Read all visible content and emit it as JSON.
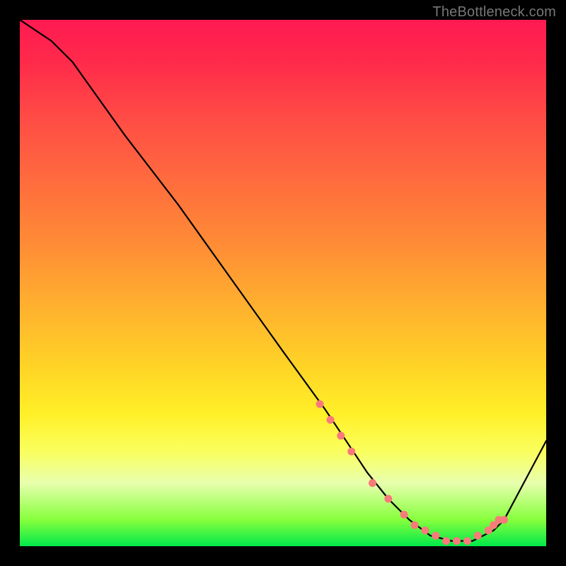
{
  "watermark": "TheBottleneck.com",
  "chart_data": {
    "type": "line",
    "title": "",
    "xlabel": "",
    "ylabel": "",
    "xlim": [
      0,
      100
    ],
    "ylim": [
      0,
      100
    ],
    "series": [
      {
        "name": "bottleneck-curve",
        "x": [
          0,
          6,
          10,
          20,
          30,
          40,
          50,
          58,
          62,
          66,
          70,
          74,
          78,
          82,
          86,
          90,
          92,
          100
        ],
        "y": [
          100,
          96,
          92,
          78,
          65,
          51,
          37,
          26,
          20,
          14,
          9,
          5,
          2,
          1,
          1,
          3,
          5,
          20
        ]
      }
    ],
    "markers": {
      "name": "highlight-points",
      "color": "#f97a7a",
      "x": [
        57,
        59,
        61,
        63,
        67,
        70,
        73,
        75,
        77,
        79,
        81,
        83,
        85,
        87,
        89,
        90,
        91,
        92
      ],
      "y": [
        27,
        24,
        21,
        18,
        12,
        9,
        6,
        4,
        3,
        2,
        1,
        1,
        1,
        2,
        3,
        4,
        5,
        5
      ]
    }
  }
}
